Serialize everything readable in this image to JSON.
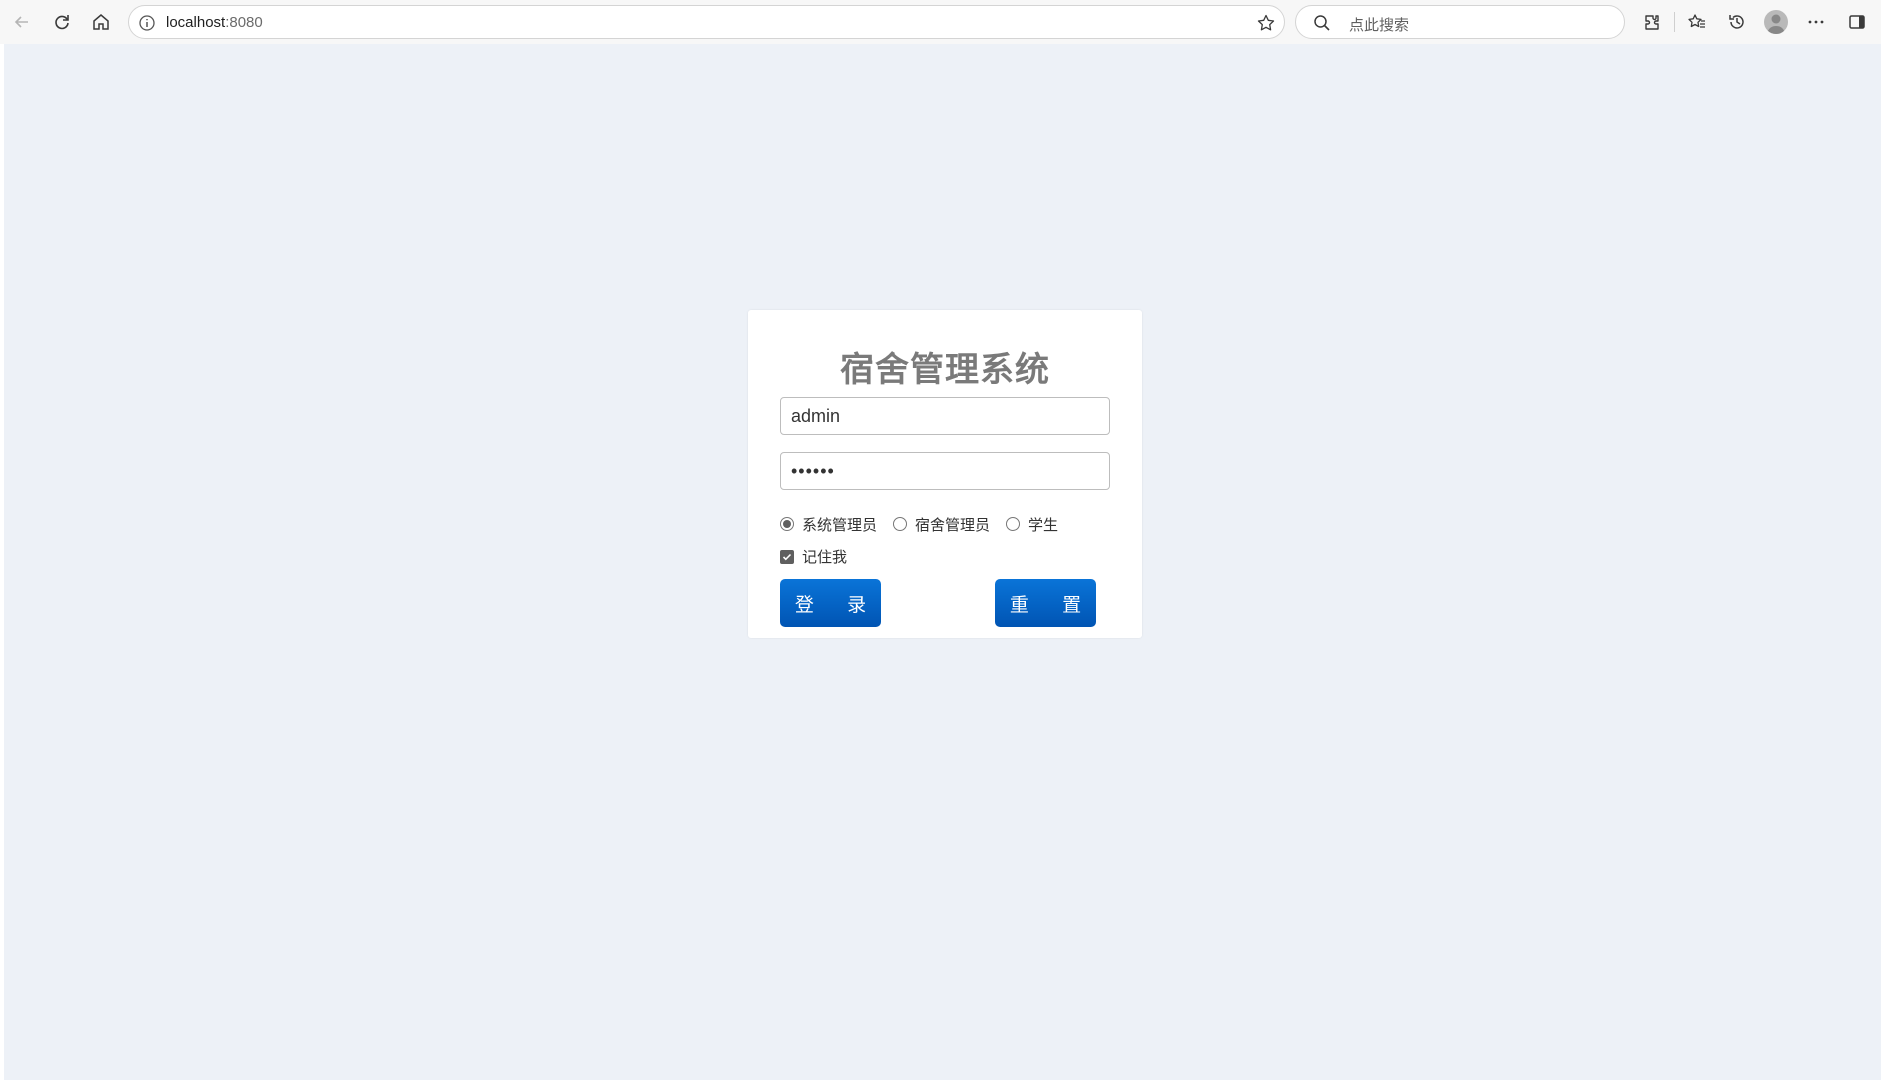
{
  "browser": {
    "url_host": "localhost",
    "url_port": ":8080",
    "search_placeholder": "点此搜索"
  },
  "login": {
    "title": "宿舍管理系统",
    "username_value": "admin",
    "password_display": "••••••",
    "roles": [
      {
        "label": "系统管理员",
        "selected": true
      },
      {
        "label": "宿舍管理员",
        "selected": false
      },
      {
        "label": "学生",
        "selected": false
      }
    ],
    "remember_label": "记住我",
    "remember_checked": true,
    "login_button": "登 录",
    "reset_button": "重 置"
  },
  "colors": {
    "page_background": "#edf1f7",
    "button_blue": "#0a6cd0",
    "title_gray": "#7a7a7a"
  }
}
